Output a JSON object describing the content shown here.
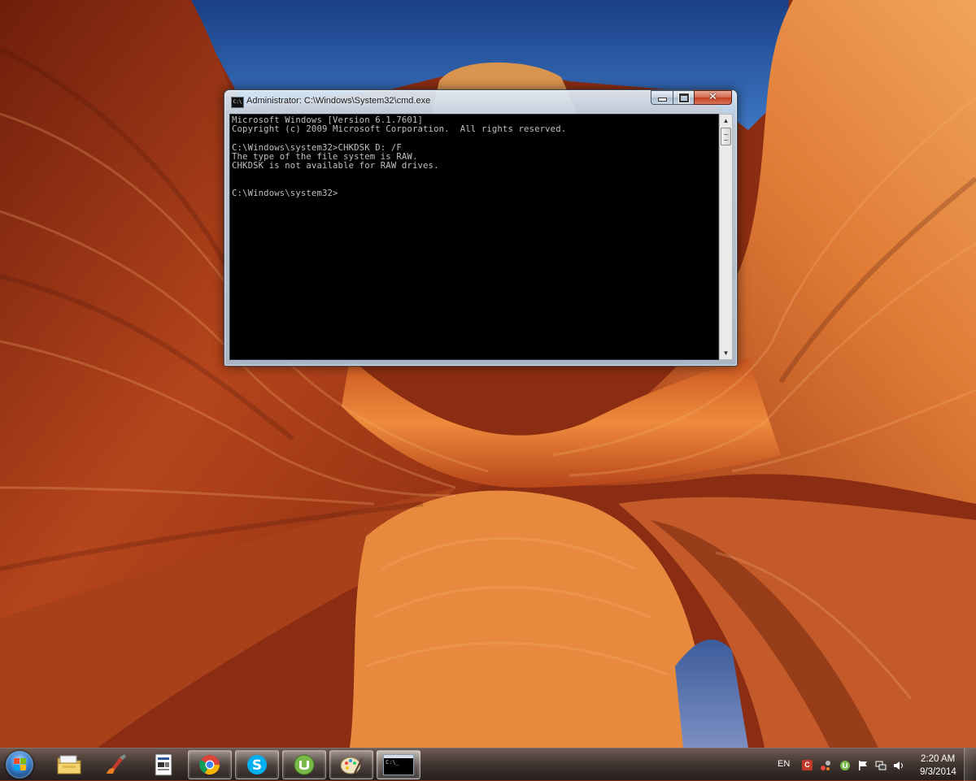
{
  "desktop": {
    "wallpaper_name": "canyon-wave-rock-wallpaper"
  },
  "cmd_window": {
    "title": "Administrator: C:\\Windows\\System32\\cmd.exe",
    "icon_label": "C:\\",
    "console_lines": [
      "Microsoft Windows [Version 6.1.7601]",
      "Copyright (c) 2009 Microsoft Corporation.  All rights reserved.",
      "",
      "C:\\Windows\\system32>CHKDSK D: /F",
      "The type of the file system is RAW.",
      "CHKDSK is not available for RAW drives.",
      "",
      "",
      "C:\\Windows\\system32>"
    ],
    "buttons": {
      "minimize": "",
      "maximize": "",
      "close": "✕"
    }
  },
  "taskbar": {
    "start": "start-orb-icon",
    "items": [
      {
        "name": "windows-explorer",
        "icon": "folder-icon",
        "active": false
      },
      {
        "name": "ccleaner",
        "icon": "ccleaner-icon",
        "active": false
      },
      {
        "name": "notepad-document",
        "icon": "document-icon",
        "active": false
      },
      {
        "name": "google-chrome",
        "icon": "chrome-icon",
        "active": true
      },
      {
        "name": "skype",
        "icon": "skype-icon",
        "active": true
      },
      {
        "name": "utorrent",
        "icon": "utorrent-icon",
        "active": true
      },
      {
        "name": "paint",
        "icon": "paint-icon",
        "active": true
      },
      {
        "name": "command-prompt",
        "icon": "cmd-icon",
        "active": true
      }
    ],
    "cmd_thumb_text": "C:\\_",
    "tray": {
      "language": "EN",
      "icons": [
        "ccleaner-tray-icon",
        "network-share-icon",
        "utorrent-tray-icon",
        "action-center-flag-icon",
        "network-icon",
        "volume-icon"
      ],
      "time": "2:20 AM",
      "date": "9/3/2014"
    }
  },
  "colors": {
    "console_bg": "#000000",
    "console_fg": "#c0c0c0",
    "close_red": "#c13f20",
    "sky_blue": "#1d4f97",
    "rock_orange": "#d8652c"
  }
}
